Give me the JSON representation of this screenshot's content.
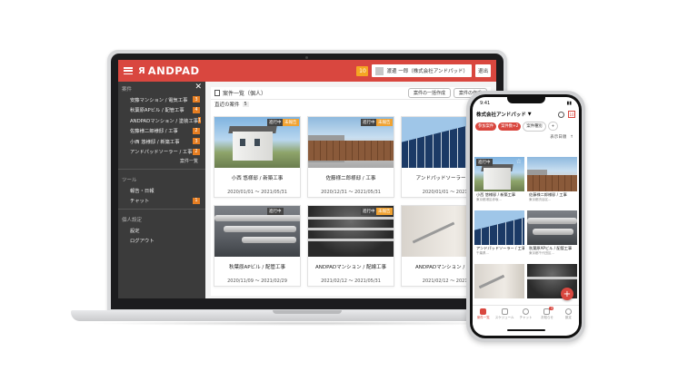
{
  "header": {
    "logo": "ANDPAD",
    "notification_count": "10",
    "user_name": "渡邊 一郎（株式会社アンドパッド）",
    "logout_label": "退出"
  },
  "sidebar": {
    "section_projects": "案件",
    "projects": [
      {
        "label": "安藤マンション / 電気工事",
        "count": "3"
      },
      {
        "label": "秋葉原APビル / 配管工事",
        "count": "4"
      },
      {
        "label": "ANDPADマンション / 塗装工事",
        "count": "1"
      },
      {
        "label": "佐藤様二郎様邸 / 工事",
        "count": "2"
      },
      {
        "label": "小西 悠様邸 / 新築工事",
        "count": "3"
      },
      {
        "label": "アンドパッドソーラー / 工事",
        "count": "2"
      }
    ],
    "more_label": "案件一覧",
    "section_tools": "ツール",
    "tools": [
      {
        "label": "報告・日報"
      },
      {
        "label": "チャット",
        "count": "1"
      }
    ],
    "section_personal": "個人設定",
    "personal": [
      {
        "label": "設定"
      },
      {
        "label": "ログアウト"
      }
    ]
  },
  "main": {
    "title": "案件一覧（個人）",
    "btn_bulk": "案件の一括作成",
    "btn_create": "案件の作成",
    "recent_label": "直近の案件",
    "recent_count": "5",
    "status_active": "進行中",
    "status_pending": "未報告",
    "cards": [
      {
        "name": "小西 悠様邸 / 新築工事",
        "date": "2020/01/01 〜 2021/05/31"
      },
      {
        "name": "佐藤様二郎様邸 / 工事",
        "date": "2020/12/31 〜 2021/05/31"
      },
      {
        "name": "アンドパッドソーラー / 工",
        "date": "2020/01/01 〜 2021/"
      },
      {
        "name": "秋葉原APビル / 配管工事",
        "date": "2020/11/09 〜 2021/02/29"
      },
      {
        "name": "ANDPADマンション / 配線工事",
        "date": "2021/02/12 〜 2021/05/31"
      },
      {
        "name": "ANDPADマンション / 塗装",
        "date": "2021/02/12 〜 2021/"
      }
    ]
  },
  "phone": {
    "time": "9:41",
    "company": "株式会社アンドパッド",
    "cal_label": "10",
    "chips": [
      "参加案件",
      "案件数+2",
      "案件種別",
      "+"
    ],
    "sort_label": "表示日順",
    "card_tag": "進行中",
    "cards": [
      {
        "name": "小西 悠様邸 / 新築工事",
        "sub": "東京都港区赤坂..."
      },
      {
        "name": "佐藤様二郎様邸 / 工事",
        "sub": "東京都渋谷区..."
      },
      {
        "name": "アンドパッドソーラー / 工事",
        "sub": "千葉県..."
      },
      {
        "name": "秋葉原APビル / 配管工事",
        "sub": "東京都千代田区..."
      }
    ],
    "tabs": [
      "案件一覧",
      "スケジュール",
      "チャット",
      "お知らせ",
      "設定"
    ],
    "tab_badge": "3"
  },
  "colors": {
    "brand": "#d9473f",
    "sidebar_bg": "#3b3b3b",
    "badge_orange": "#e67e22"
  }
}
